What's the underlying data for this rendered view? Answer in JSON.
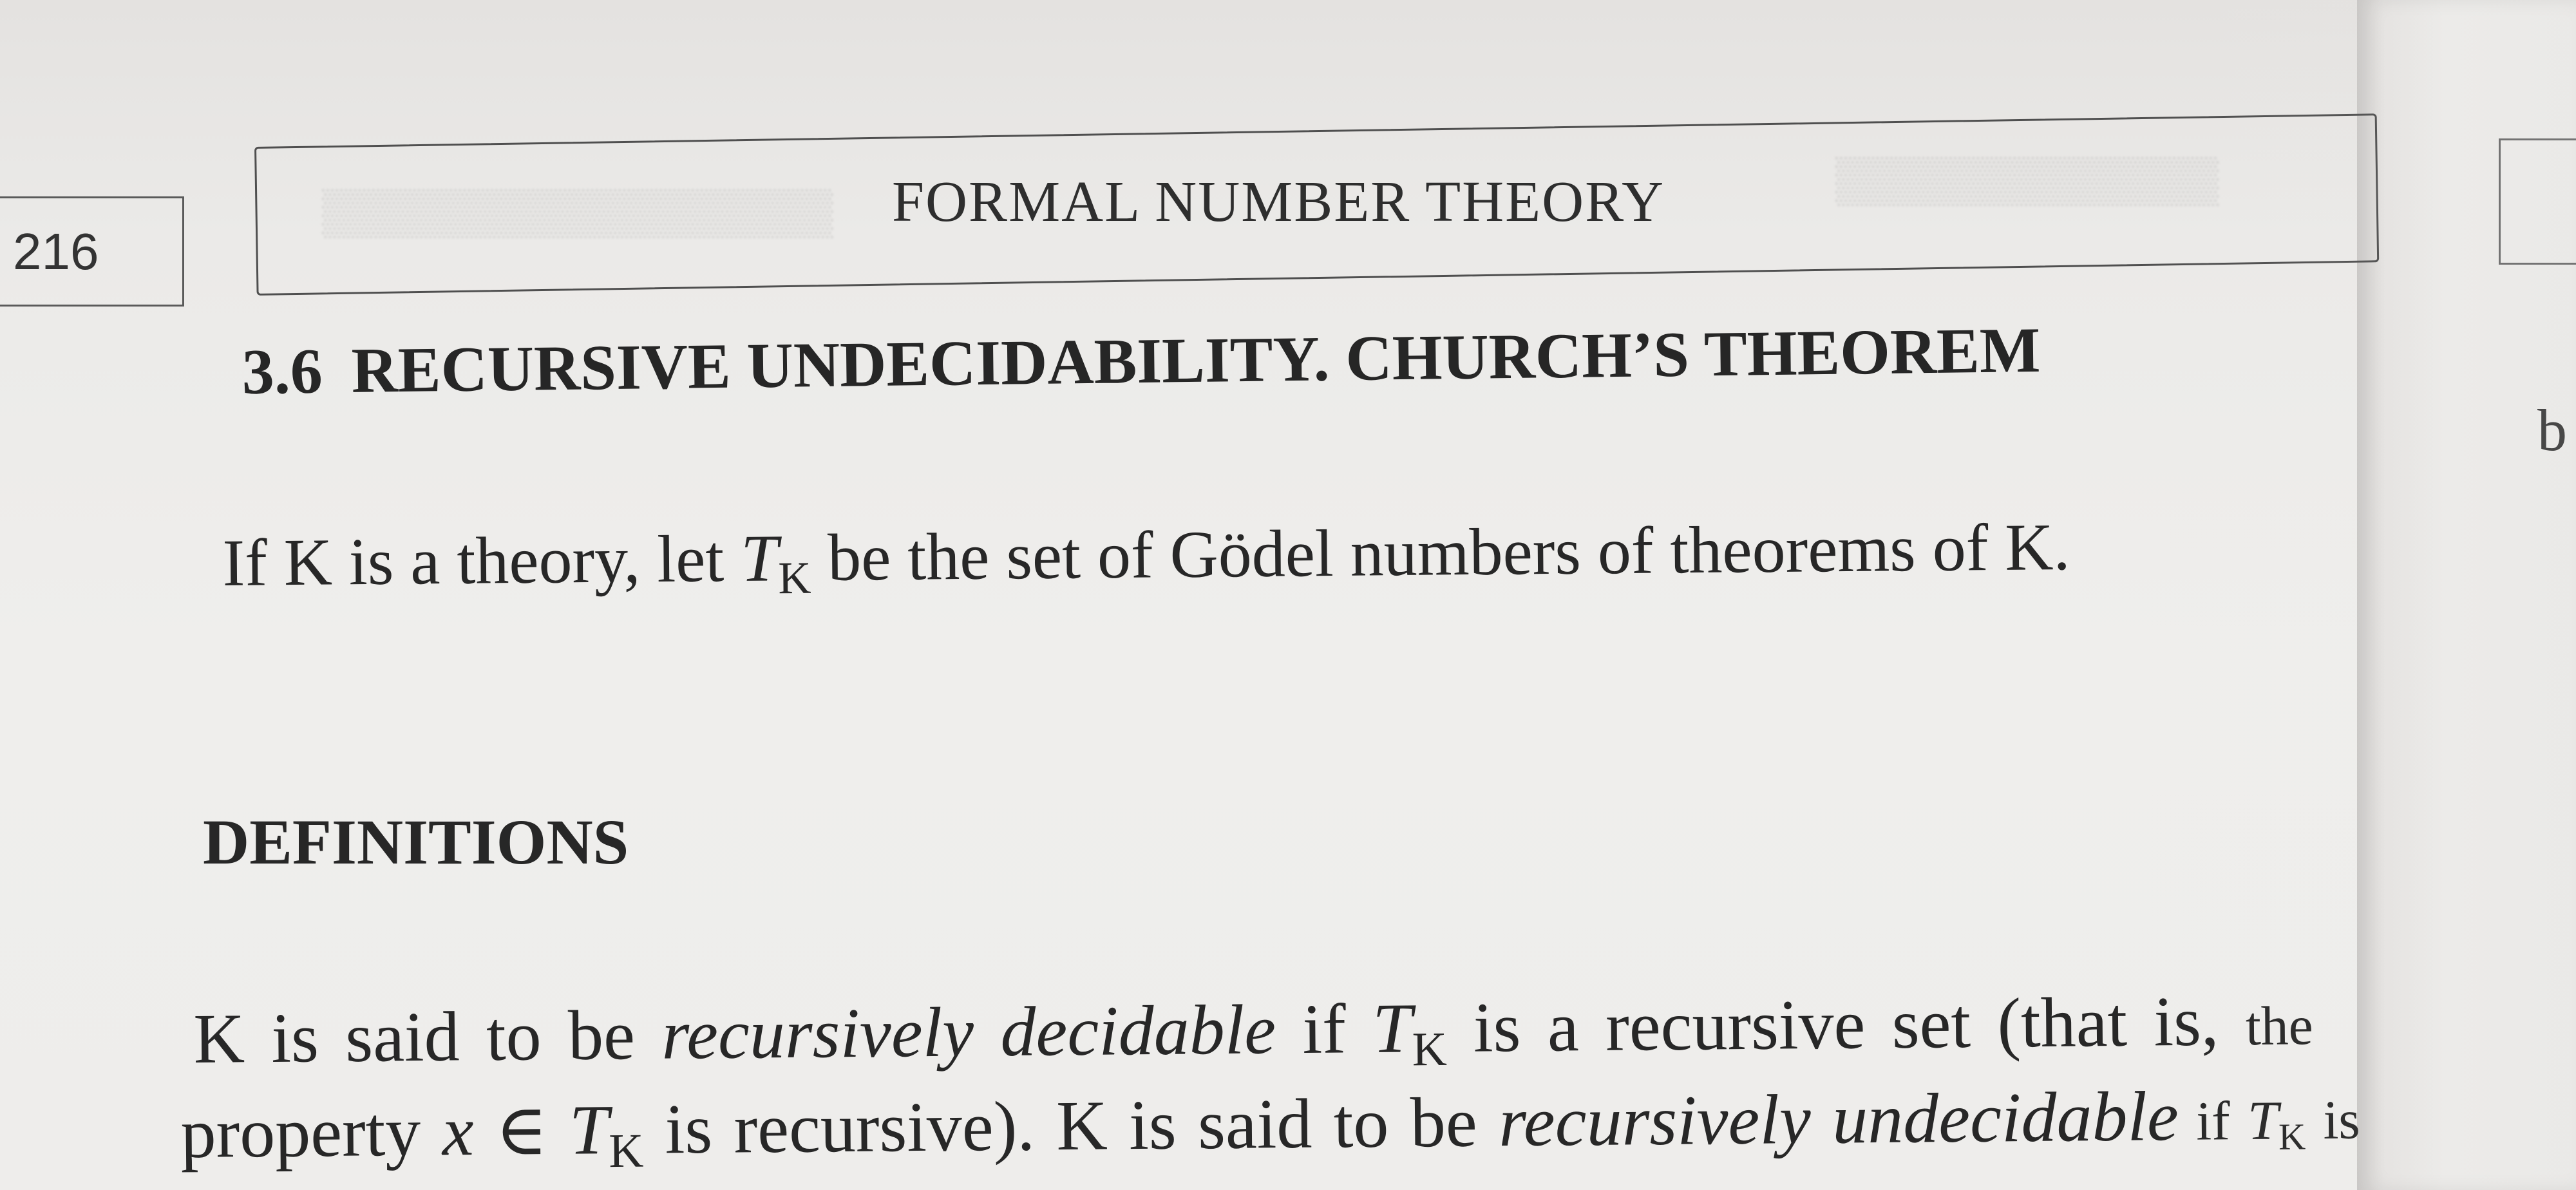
{
  "header": {
    "page_number": "216",
    "running_title": "FORMAL NUMBER THEORY"
  },
  "section": {
    "number": "3.6",
    "title": "RECURSIVE UNDECIDABILITY. CHURCH’S THEOREM"
  },
  "intro": {
    "part1": "If K is a theory, let ",
    "T": "T",
    "sub": "K",
    "part2": " be the set of Gödel numbers of theorems of K."
  },
  "definitions": {
    "heading": "DEFINITIONS",
    "line1": {
      "a": "K is said to be ",
      "a_em": "recursively decidable",
      "b": " if ",
      "T": "T",
      "sub": "K",
      "c": " is a recursive set (that is, ",
      "tail": "the"
    },
    "line2": {
      "a": "property ",
      "x": "x",
      "in": " ∈ ",
      "T": "T",
      "sub": "K",
      "b": " is recursive). K is said to be ",
      "b_em": "recursively undecidable",
      "c": " if ",
      "T2": "T",
      "sub2": "K",
      "d": " is"
    }
  },
  "right_page": {
    "letter": "b"
  }
}
